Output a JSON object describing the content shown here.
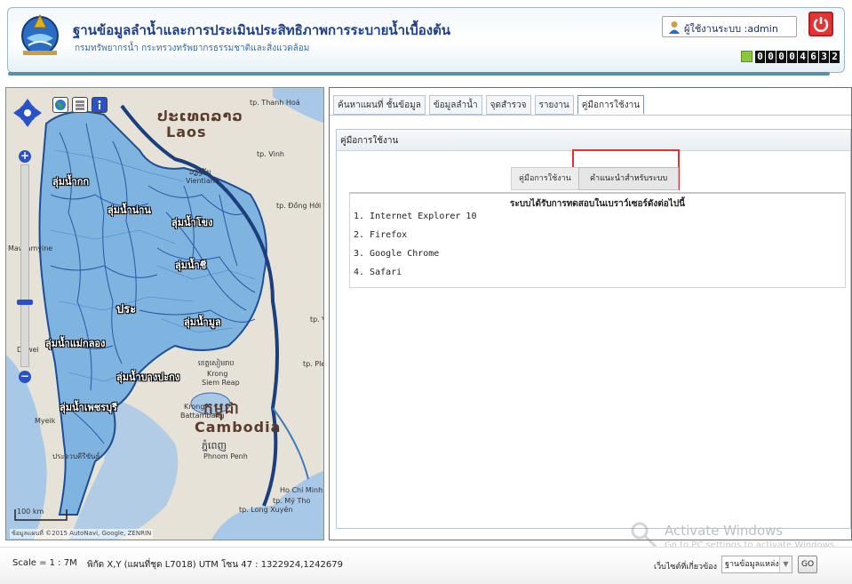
{
  "header": {
    "title": "ฐานข้อมูลลำน้ำและการประเมินประสิทธิภาพการระบายน้ำเบื้องต้น",
    "subtitle": "กรมทรัพยากรน้ำ กระทรวงทรัพยากรธรรมชาติและสิ่งแวดล้อม",
    "user_label": "ผู้ใช้งานระบบ :admin",
    "visitor_counter": [
      "0",
      "0",
      "0",
      "0",
      "4",
      "6",
      "3",
      "2"
    ],
    "logout_icon": "power-icon",
    "user_icon": "user-icon",
    "counter_icon": "counter-icon"
  },
  "map": {
    "basin_labels": [
      "ลุ่มน้ำโขง",
      "ลุ่มน้ำกก",
      "ลุ่มน้ำน่าน",
      "ลุ่มน้ำชี",
      "ลุ่มน้ำมูล",
      "ลุ่มน้ำแม่กลอง",
      "ลุ่มน้ำบางปะกง",
      "ลุ่มน้ำเพชรบุรี",
      "ประ"
    ],
    "country_labels": [
      "ປະເທດລາວ",
      "Laos",
      "កម្ពុជា",
      "Cambodia"
    ],
    "city_labels": [
      "tp. Thanh Hoá",
      "tp. Vinh",
      "ວຽງຈັນ",
      "Vientiane",
      "tp. Đồng Hới",
      "Mawlamyine",
      "Dawei",
      "Myeik",
      "tp. Plei",
      "ខេត្តសៀមរាប",
      "Krong",
      "Siem Reap",
      "Krong",
      "Battambang",
      "ភ្នំពេញ",
      "Phnom Penh",
      "Ho Chi Minh",
      "tp. Mỹ Tho",
      "tp. Long Xuyên",
      "ประจวบคีรีขันธ์",
      "tp. Vi"
    ],
    "scale_text": "100 km",
    "attribution": "ข้อมูลแผนที่ ©2015 AutoNavi, Google, ZENRIN",
    "tool_icons": [
      "globe-icon",
      "layers-icon",
      "info-icon"
    ]
  },
  "tabs": [
    {
      "label": "ค้นหาแผนที่ ชั้นข้อมูล",
      "active": false
    },
    {
      "label": "ข้อมูลลำน้ำ",
      "active": false
    },
    {
      "label": "จุดสำรวจ",
      "active": false
    },
    {
      "label": "รายงาน",
      "active": false
    },
    {
      "label": "คู่มือการใช้งาน",
      "active": true
    }
  ],
  "content": {
    "title": "คู่มือการใช้งาน",
    "subtabs": [
      "คู่มือการใช้งาน",
      "คำแนะนำสำหรับระบบ"
    ],
    "heading": "ระบบได้รับการทดสอบในเบราว์เซอร์ดังต่อไปนี้",
    "browsers": [
      "1. Internet Explorer 10",
      "2. Firefox",
      "3. Google Chrome",
      "4. Safari"
    ]
  },
  "watermark": {
    "title": "Activate Windows",
    "subtitle": "Go to PC settings to activate Windows."
  },
  "statusbar": {
    "scale": "Scale = 1 : 7M",
    "coordinates": "พิกัด X,Y (แผนที่ชุด L7018) UTM โซน 47 : 1322924,1242679",
    "related_label": "เว็บไซต์ที่เกี่ยวข้อง",
    "related_selected": "ฐานข้อมูลแหล่งน้ำ",
    "go_label": "GO"
  }
}
